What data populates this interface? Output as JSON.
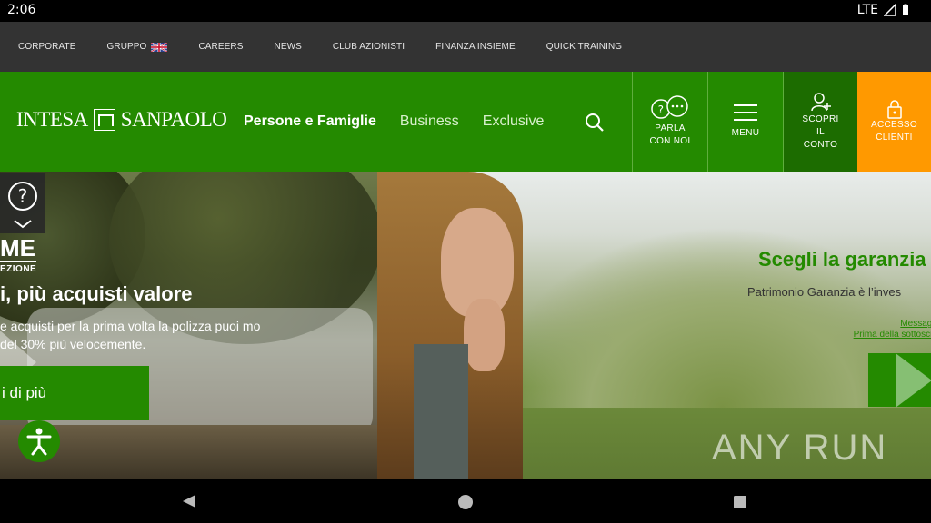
{
  "status_bar": {
    "time": "2:06",
    "network": "LTE"
  },
  "top_nav": {
    "items": [
      "CORPORATE",
      "GRUPPO",
      "CAREERS",
      "NEWS",
      "CLUB AZIONISTI",
      "FINANZA INSIEME",
      "QUICK TRAINING"
    ]
  },
  "header": {
    "logo_left": "INTESA",
    "logo_right": "SANPAOLO",
    "nav": [
      "Persone e Famiglie",
      "Business",
      "Exclusive"
    ],
    "parla": [
      "PARLA",
      "CON NOI"
    ],
    "menu": "MENU",
    "scopri": [
      "SCOPRI",
      "IL",
      "CONTO"
    ],
    "accesso": [
      "ACCESSO",
      "CLIENTI"
    ]
  },
  "hero_left": {
    "badge_big": "ME",
    "badge_small": "EZIONE",
    "title": "i, più acquisti valore",
    "text": "e acquisti per la prima volta la polizza puoi mo del 30% più velocemente.",
    "cta": "i di più"
  },
  "hero_right": {
    "title": "Scegli la garanzia",
    "text": "Patrimonio Garanzia è l’inves",
    "legal_1": "Messaggio p",
    "legal_2": "Prima della sottoscrizion"
  },
  "watermark": "ANY RUN",
  "colors": {
    "brand_green": "#248a00",
    "dark_green": "#1c6c00",
    "orange": "#ff9900",
    "topbar": "#333333"
  }
}
